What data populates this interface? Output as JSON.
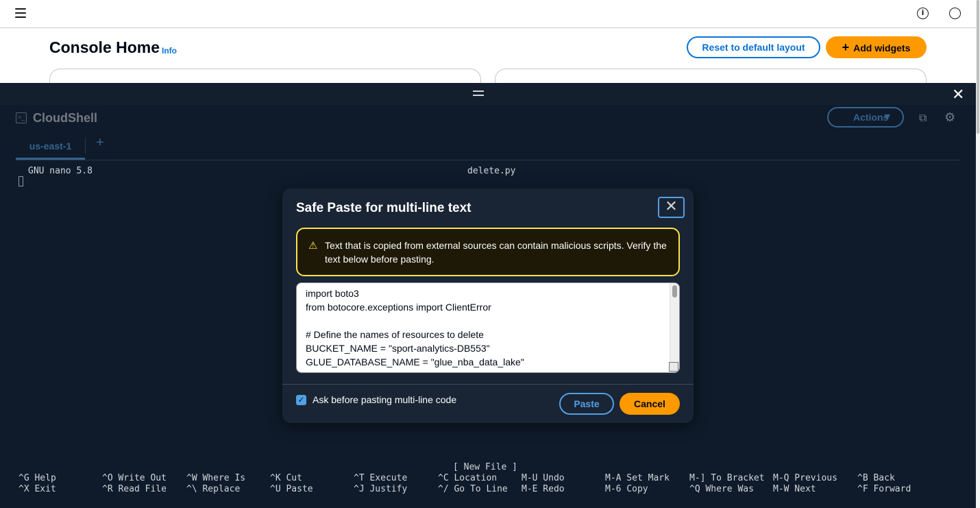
{
  "console": {
    "page_title": "Console Home",
    "info_link": "Info",
    "reset_button": "Reset to default layout",
    "add_widgets_icon": "+",
    "add_widgets_button": "Add widgets",
    "info_icon": "i"
  },
  "cloudshell": {
    "close_glyph": "✕",
    "icon_glyph": ">_",
    "title": "CloudShell",
    "actions_button": "Actions",
    "actions_caret": "▼",
    "external_glyph": "⧉",
    "gear_glyph": "⚙",
    "tab_label": "us-east-1",
    "add_tab": "+"
  },
  "nano": {
    "version": "GNU nano 5.8",
    "filename": "delete.py",
    "status": "[ New File ]",
    "shortcuts_row1": [
      "^G Help",
      "^O Write Out",
      "^W Where Is",
      "^K Cut",
      "^T Execute",
      "^C Location",
      "M-U Undo",
      "M-A Set Mark",
      "M-] To Bracket",
      "M-Q Previous",
      "^B Back"
    ],
    "shortcuts_row2": [
      "^X Exit",
      "^R Read File",
      "^\\ Replace",
      "^U Paste",
      "^J Justify",
      "^/ Go To Line",
      "M-E Redo",
      "M-6 Copy",
      "^Q Where Was",
      "M-W Next",
      "^F Forward"
    ]
  },
  "modal": {
    "title": "Safe Paste for multi-line text",
    "close_glyph": "✕",
    "warning_glyph": "⚠",
    "warning_text": "Text that is copied from external sources can contain malicious scripts. Verify the text below before pasting.",
    "code_lines": [
      "import boto3",
      "from botocore.exceptions import ClientError",
      "",
      "# Define the names of resources to delete",
      "BUCKET_NAME = \"sport-analytics-DB553\"",
      "GLUE_DATABASE_NAME = \"glue_nba_data_lake\""
    ],
    "checkbox_glyph": "✓",
    "checkbox_label": "Ask before pasting multi-line code",
    "checkbox_checked": true,
    "paste_button": "Paste",
    "cancel_button": "Cancel"
  },
  "colors": {
    "accent": "#0972d3",
    "orange": "#ff9900",
    "warning": "#ffe347",
    "shell_bg": "#0f1b2a"
  }
}
